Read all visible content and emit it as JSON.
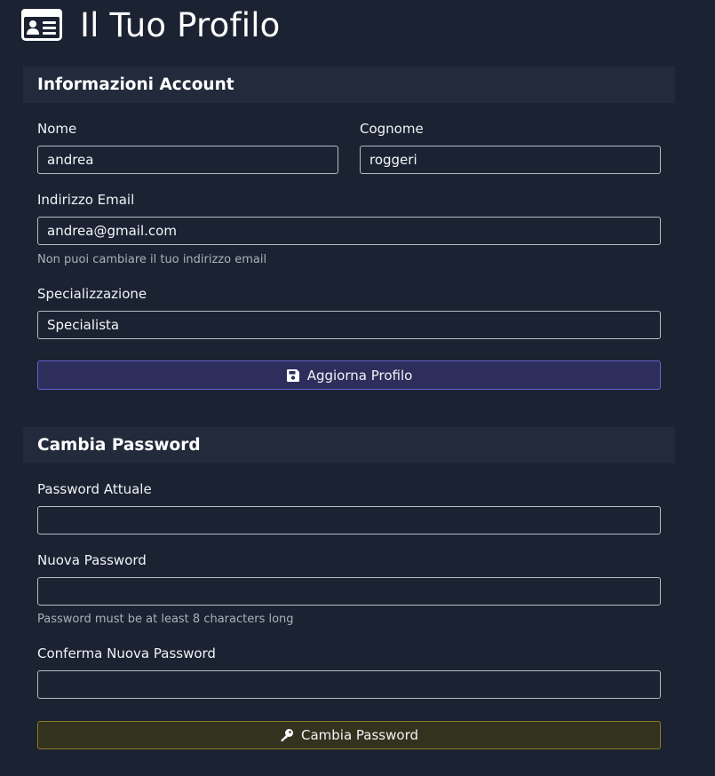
{
  "header": {
    "title": "Il Tuo Profilo",
    "icon": "id-card-icon"
  },
  "account": {
    "title": "Informazioni Account",
    "first_name": {
      "label": "Nome",
      "value": "andrea"
    },
    "last_name": {
      "label": "Cognome",
      "value": "roggeri"
    },
    "email": {
      "label": "Indirizzo Email",
      "value": "andrea@gmail.com",
      "help": "Non puoi cambiare il tuo indirizzo email"
    },
    "specialization": {
      "label": "Specializzazione",
      "value": "Specialista"
    },
    "update_button": {
      "label": "Aggiorna Profilo",
      "icon": "save-icon"
    }
  },
  "password": {
    "title": "Cambia Password",
    "current": {
      "label": "Password Attuale",
      "value": ""
    },
    "new": {
      "label": "Nuova Password",
      "value": "",
      "help": "Password must be at least 8 characters long"
    },
    "confirm": {
      "label": "Conferma Nuova Password",
      "value": ""
    },
    "change_button": {
      "label": "Cambia Password",
      "icon": "key-icon"
    }
  },
  "colors": {
    "background": "#1b2232",
    "card_header": "#222a3b",
    "primary_button_bg": "#2e2e5c",
    "primary_button_border": "#6563d1",
    "warning_button_bg": "#33321f",
    "warning_button_border": "#8c7a1f"
  }
}
